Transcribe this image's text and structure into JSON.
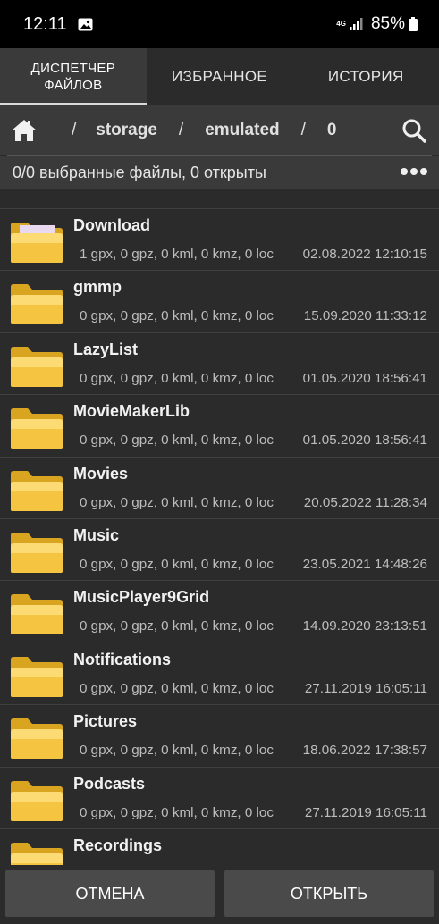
{
  "status": {
    "time": "12:11",
    "network": "4G",
    "battery": "85%"
  },
  "tabs": [
    {
      "label": "ДИСПЕТЧЕР\nФАЙЛОВ",
      "active": true
    },
    {
      "label": "ИЗБРАННОЕ",
      "active": false
    },
    {
      "label": "ИСТОРИЯ",
      "active": false
    }
  ],
  "path": {
    "separator": "/",
    "segments": [
      "storage",
      "emulated",
      "0"
    ]
  },
  "selection": {
    "text": "0/0 выбранные файлы, 0 открыты"
  },
  "files": [
    {
      "name": "Download",
      "info": "1 gpx, 0 gpz, 0 kml, 0 kmz, 0 loc",
      "date": "02.08.2022 12:10:15"
    },
    {
      "name": "gmmp",
      "info": "0 gpx, 0 gpz, 0 kml, 0 kmz, 0 loc",
      "date": "15.09.2020 11:33:12"
    },
    {
      "name": "LazyList",
      "info": "0 gpx, 0 gpz, 0 kml, 0 kmz, 0 loc",
      "date": "01.05.2020 18:56:41"
    },
    {
      "name": "MovieMakerLib",
      "info": "0 gpx, 0 gpz, 0 kml, 0 kmz, 0 loc",
      "date": "01.05.2020 18:56:41"
    },
    {
      "name": "Movies",
      "info": "0 gpx, 0 gpz, 0 kml, 0 kmz, 0 loc",
      "date": "20.05.2022 11:28:34"
    },
    {
      "name": "Music",
      "info": "0 gpx, 0 gpz, 0 kml, 0 kmz, 0 loc",
      "date": "23.05.2021 14:48:26"
    },
    {
      "name": "MusicPlayer9Grid",
      "info": "0 gpx, 0 gpz, 0 kml, 0 kmz, 0 loc",
      "date": "14.09.2020 23:13:51"
    },
    {
      "name": "Notifications",
      "info": "0 gpx, 0 gpz, 0 kml, 0 kmz, 0 loc",
      "date": "27.11.2019 16:05:11"
    },
    {
      "name": "Pictures",
      "info": "0 gpx, 0 gpz, 0 kml, 0 kmz, 0 loc",
      "date": "18.06.2022 17:38:57"
    },
    {
      "name": "Podcasts",
      "info": "0 gpx, 0 gpz, 0 kml, 0 kmz, 0 loc",
      "date": "27.11.2019 16:05:11"
    },
    {
      "name": "Recordings",
      "info": "",
      "date": ""
    }
  ],
  "buttons": {
    "cancel": "ОТМЕНА",
    "open": "ОТКРЫТЬ"
  },
  "colors": {
    "folder": "#f5c542",
    "folder_light": "#ffe48a",
    "background": "#2b2b2b",
    "bar": "#3a3a3a",
    "button": "#4a4a4a"
  },
  "icons": [
    "gallery-icon",
    "signal-icon",
    "battery-icon",
    "home-icon",
    "search-icon",
    "more-icon",
    "folder-icon"
  ]
}
